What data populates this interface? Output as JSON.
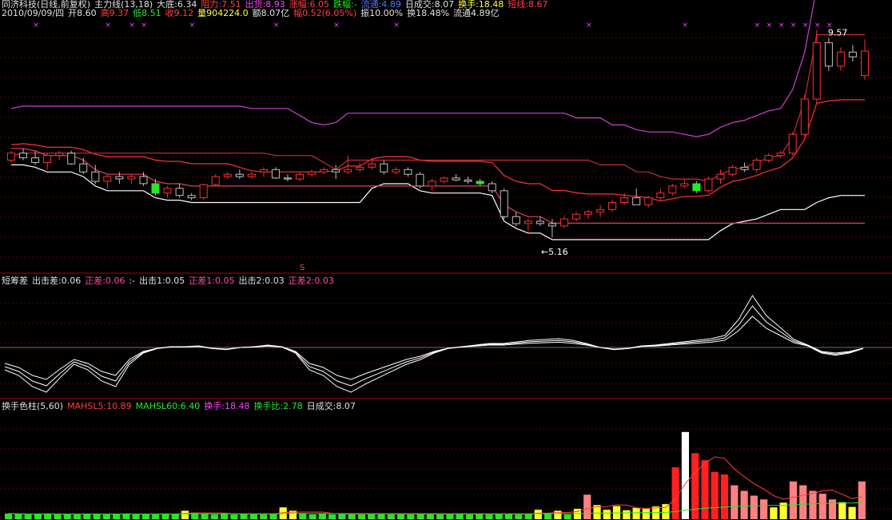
{
  "header": {
    "title": "同济科技(日线,前复权)",
    "indicator": "主力线(13,18)",
    "values": [
      {
        "label": "大底:6.34",
        "color": "#e0e0e0"
      },
      {
        "label": "阻力:7.51",
        "color": "#ff4040"
      },
      {
        "label": "出货:8.93",
        "color": "#ff40ff"
      },
      {
        "label": "涨幅:6.05",
        "color": "#ff4040"
      },
      {
        "label": "跌幅:-",
        "color": "#27e827"
      },
      {
        "label": "流通:4.89",
        "color": "#4a78ff"
      },
      {
        "label": "日成交:8.07",
        "color": "#e0e0e0"
      },
      {
        "label": "换手:18.48",
        "color": "#ffff40"
      },
      {
        "label": "短线:8.67",
        "color": "#ff4040"
      }
    ]
  },
  "quote": {
    "date": "2010/09/09/四",
    "items": [
      {
        "label": "开8.60",
        "color": "#e0e0e0"
      },
      {
        "label": "高9.37",
        "color": "#ff4040"
      },
      {
        "label": "低8.51",
        "color": "#27e827"
      },
      {
        "label": "收9.12",
        "color": "#ff4040"
      },
      {
        "label": "量904224.0",
        "color": "#ffff40"
      },
      {
        "label": "额8.07亿",
        "color": "#e0e0e0"
      },
      {
        "label": "幅0.52(6.05%)",
        "color": "#ff4040"
      },
      {
        "label": "振10.00%",
        "color": "#e0e0e0"
      },
      {
        "label": "换18.48%",
        "color": "#e0e0e0"
      },
      {
        "label": "流通4.89亿",
        "color": "#e0e0e0"
      }
    ]
  },
  "panel2_header": {
    "title": "短筹差",
    "values": [
      {
        "label": "出击差:0.06",
        "color": "#e0e0e0"
      },
      {
        "label": "正差:0.06",
        "color": "#ff4d9a"
      },
      {
        "label": ":-",
        "color": "#e0e0e0"
      },
      {
        "label": "出击1:0.05",
        "color": "#e0e0e0"
      },
      {
        "label": "正差1:0.05",
        "color": "#ff4d9a"
      },
      {
        "label": "出击2:0.03",
        "color": "#e0e0e0"
      },
      {
        "label": "正差2:0.03",
        "color": "#ff4d9a"
      }
    ]
  },
  "panel3_header": {
    "title": "换手色柱(5,60)",
    "values": [
      {
        "label": "MAHSL5:10.89",
        "color": "#ff4040"
      },
      {
        "label": "MAHSL60:6.40",
        "color": "#27e827"
      },
      {
        "label": "换手:18.48",
        "color": "#ff40ff"
      },
      {
        "label": "换手比:2.78",
        "color": "#27e827"
      },
      {
        "label": "日成交:8.07",
        "color": "#e0e0e0"
      }
    ]
  },
  "chart_data": [
    {
      "type": "candlestick",
      "title": "同济科技(日线,前复权)",
      "indicator": "主力线(13,18)",
      "annotations": [
        {
          "text": "9.57",
          "kind": "high"
        },
        {
          "text": "←5.16",
          "kind": "low"
        },
        {
          "text": "S",
          "kind": "signal",
          "color": "#ff4040"
        }
      ],
      "price_range": [
        4.6,
        9.8
      ],
      "x_count": 72,
      "candles": [
        [
          6.8,
          7.0,
          6.75,
          6.95
        ],
        [
          6.95,
          7.05,
          6.8,
          6.85
        ],
        [
          6.85,
          7.0,
          6.7,
          6.75
        ],
        [
          6.75,
          6.95,
          6.6,
          6.9
        ],
        [
          6.9,
          7.0,
          6.8,
          6.95
        ],
        [
          6.95,
          7.0,
          6.7,
          6.72
        ],
        [
          6.72,
          6.85,
          6.5,
          6.55
        ],
        [
          6.55,
          6.7,
          6.3,
          6.35
        ],
        [
          6.35,
          6.5,
          6.2,
          6.45
        ],
        [
          6.45,
          6.55,
          6.3,
          6.4
        ],
        [
          6.4,
          6.5,
          6.3,
          6.45
        ],
        [
          6.45,
          6.55,
          6.25,
          6.3
        ],
        [
          6.3,
          6.4,
          6.05,
          6.1
        ],
        [
          6.1,
          6.25,
          6.0,
          6.2
        ],
        [
          6.2,
          6.3,
          6.0,
          6.05
        ],
        [
          6.05,
          6.1,
          5.95,
          6.0
        ],
        [
          6.0,
          6.3,
          5.95,
          6.28
        ],
        [
          6.28,
          6.5,
          6.25,
          6.45
        ],
        [
          6.45,
          6.55,
          6.4,
          6.5
        ],
        [
          6.5,
          6.6,
          6.4,
          6.45
        ],
        [
          6.45,
          6.55,
          6.4,
          6.5
        ],
        [
          6.55,
          6.65,
          6.45,
          6.6
        ],
        [
          6.6,
          6.65,
          6.4,
          6.42
        ],
        [
          6.42,
          6.5,
          6.35,
          6.4
        ],
        [
          6.4,
          6.55,
          6.35,
          6.5
        ],
        [
          6.5,
          6.6,
          6.45,
          6.55
        ],
        [
          6.55,
          6.65,
          6.5,
          6.6
        ],
        [
          6.6,
          6.7,
          6.4,
          6.55
        ],
        [
          6.55,
          6.9,
          6.5,
          6.6
        ],
        [
          6.6,
          6.75,
          6.55,
          6.65
        ],
        [
          6.65,
          6.8,
          6.6,
          6.72
        ],
        [
          6.72,
          6.8,
          6.5,
          6.55
        ],
        [
          6.55,
          6.65,
          6.5,
          6.6
        ],
        [
          6.6,
          6.65,
          6.45,
          6.5
        ],
        [
          6.5,
          6.55,
          6.2,
          6.25
        ],
        [
          6.25,
          6.4,
          6.15,
          6.35
        ],
        [
          6.35,
          6.45,
          6.3,
          6.42
        ],
        [
          6.42,
          6.5,
          6.35,
          6.38
        ],
        [
          6.38,
          6.45,
          6.3,
          6.35
        ],
        [
          6.35,
          6.4,
          6.25,
          6.3
        ],
        [
          6.3,
          6.35,
          6.1,
          6.15
        ],
        [
          6.15,
          6.2,
          5.55,
          5.6
        ],
        [
          5.6,
          5.7,
          5.4,
          5.45
        ],
        [
          5.45,
          5.55,
          5.3,
          5.5
        ],
        [
          5.5,
          5.6,
          5.4,
          5.45
        ],
        [
          5.45,
          5.55,
          5.16,
          5.4
        ],
        [
          5.4,
          5.6,
          5.35,
          5.55
        ],
        [
          5.55,
          5.7,
          5.5,
          5.65
        ],
        [
          5.65,
          5.75,
          5.55,
          5.7
        ],
        [
          5.7,
          5.85,
          5.6,
          5.75
        ],
        [
          5.75,
          5.95,
          5.7,
          5.9
        ],
        [
          5.9,
          6.1,
          5.85,
          6.0
        ],
        [
          6.0,
          6.2,
          5.95,
          5.85
        ],
        [
          5.85,
          6.05,
          5.8,
          6.0
        ],
        [
          6.0,
          6.2,
          5.95,
          6.1
        ],
        [
          6.1,
          6.3,
          6.05,
          6.25
        ],
        [
          6.25,
          6.4,
          6.2,
          6.3
        ],
        [
          6.3,
          6.35,
          6.1,
          6.15
        ],
        [
          6.15,
          6.45,
          6.1,
          6.4
        ],
        [
          6.4,
          6.6,
          6.3,
          6.5
        ],
        [
          6.5,
          6.7,
          6.45,
          6.65
        ],
        [
          6.65,
          6.75,
          6.55,
          6.6
        ],
        [
          6.6,
          6.85,
          6.55,
          6.8
        ],
        [
          6.8,
          6.95,
          6.75,
          6.9
        ],
        [
          6.9,
          7.0,
          6.85,
          6.95
        ],
        [
          6.95,
          7.4,
          6.9,
          7.35
        ],
        [
          7.35,
          8.2,
          7.3,
          8.1
        ],
        [
          8.1,
          9.57,
          8.0,
          9.3
        ],
        [
          9.3,
          9.4,
          8.7,
          8.8
        ],
        [
          8.8,
          9.2,
          8.7,
          9.1
        ],
        [
          9.1,
          9.25,
          8.9,
          9.0
        ],
        [
          8.6,
          9.37,
          8.51,
          9.12
        ]
      ]
    },
    {
      "type": "line",
      "title": "短筹差",
      "series": [
        {
          "name": "出击差",
          "color": "#ffffff"
        },
        {
          "name": "出击1",
          "color": "#ffffff"
        },
        {
          "name": "出击2",
          "color": "#ffffff"
        }
      ]
    },
    {
      "type": "bar",
      "title": "换手色柱(5,60)",
      "series": [
        {
          "name": "MAHSL5",
          "color": "#ff4040"
        },
        {
          "name": "MAHSL60",
          "color": "#27e827"
        }
      ],
      "ylim": [
        0,
        22
      ],
      "values": [
        1.2,
        1.1,
        1.0,
        1.1,
        1.2,
        1.0,
        1.1,
        1.0,
        1.2,
        1.1,
        1.0,
        1.1,
        1.2,
        1.0,
        1.1,
        1.0,
        1.2,
        1.1,
        1.8,
        1.4,
        1.2,
        1.0,
        1.1,
        1.0,
        1.2,
        1.1,
        1.0,
        1.1,
        2.5,
        1.8,
        1.2,
        1.0,
        1.1,
        1.0,
        1.2,
        1.1,
        1.0,
        1.1,
        1.2,
        1.0,
        1.1,
        1.0,
        1.2,
        1.1,
        1.0,
        1.1,
        1.2,
        1.0,
        1.1,
        1.0,
        1.2,
        1.1,
        1.0,
        1.1,
        2.0,
        1.2,
        1.8,
        1.0,
        2.2,
        5.2,
        3.0,
        2.0,
        2.8,
        1.9,
        2.4,
        2.2,
        2.7,
        3.2,
        11.0,
        18.48,
        14.0,
        12.5,
        10.0,
        9.5,
        7.2,
        6.0,
        5.0,
        4.2,
        2.5,
        3.5,
        8.0,
        7.2,
        6.0,
        5.4,
        4.2,
        3.6,
        2.6,
        8.0
      ]
    }
  ]
}
